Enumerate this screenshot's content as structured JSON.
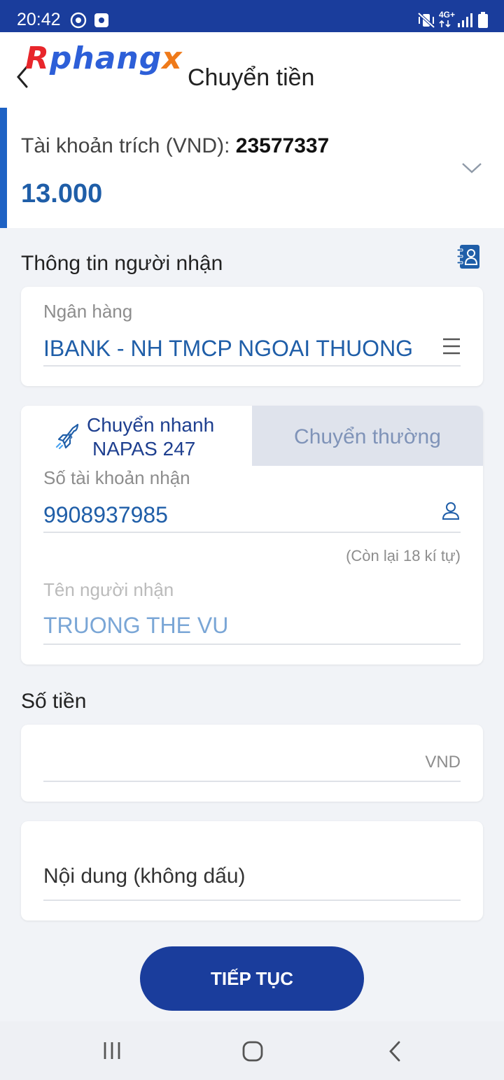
{
  "status_bar": {
    "time": "20:42",
    "network": "4G+"
  },
  "header": {
    "logo_part1": "R",
    "logo_part2": "phang",
    "logo_part3": "x",
    "title": "Chuyển tiền"
  },
  "account": {
    "label": "Tài khoản trích (VND): ",
    "number": "23577337",
    "balance": "13.000"
  },
  "recipient_section": {
    "title": "Thông tin người nhận"
  },
  "bank": {
    "label": "Ngân hàng",
    "value": "IBANK - NH TMCP NGOAI THUONG"
  },
  "transfer_tabs": {
    "fast_line1": "Chuyển nhanh",
    "fast_line2": "NAPAS 247",
    "normal": "Chuyển thường"
  },
  "account_field": {
    "label": "Số tài khoản nhận",
    "value": "9908937985",
    "remaining": "(Còn lại 18 kí tự)"
  },
  "name_field": {
    "label": "Tên người nhận",
    "value": "TRUONG THE VU"
  },
  "amount_section": {
    "title": "Số tiền",
    "currency": "VND"
  },
  "content_field": {
    "placeholder": "Nội dung (không dấu)"
  },
  "continue_button": {
    "label": "TIẾP TỤC"
  },
  "colors": {
    "primary": "#1a3d9c",
    "accent_blue": "#1f5ea8",
    "tab_inactive": "#dfe3ec"
  }
}
